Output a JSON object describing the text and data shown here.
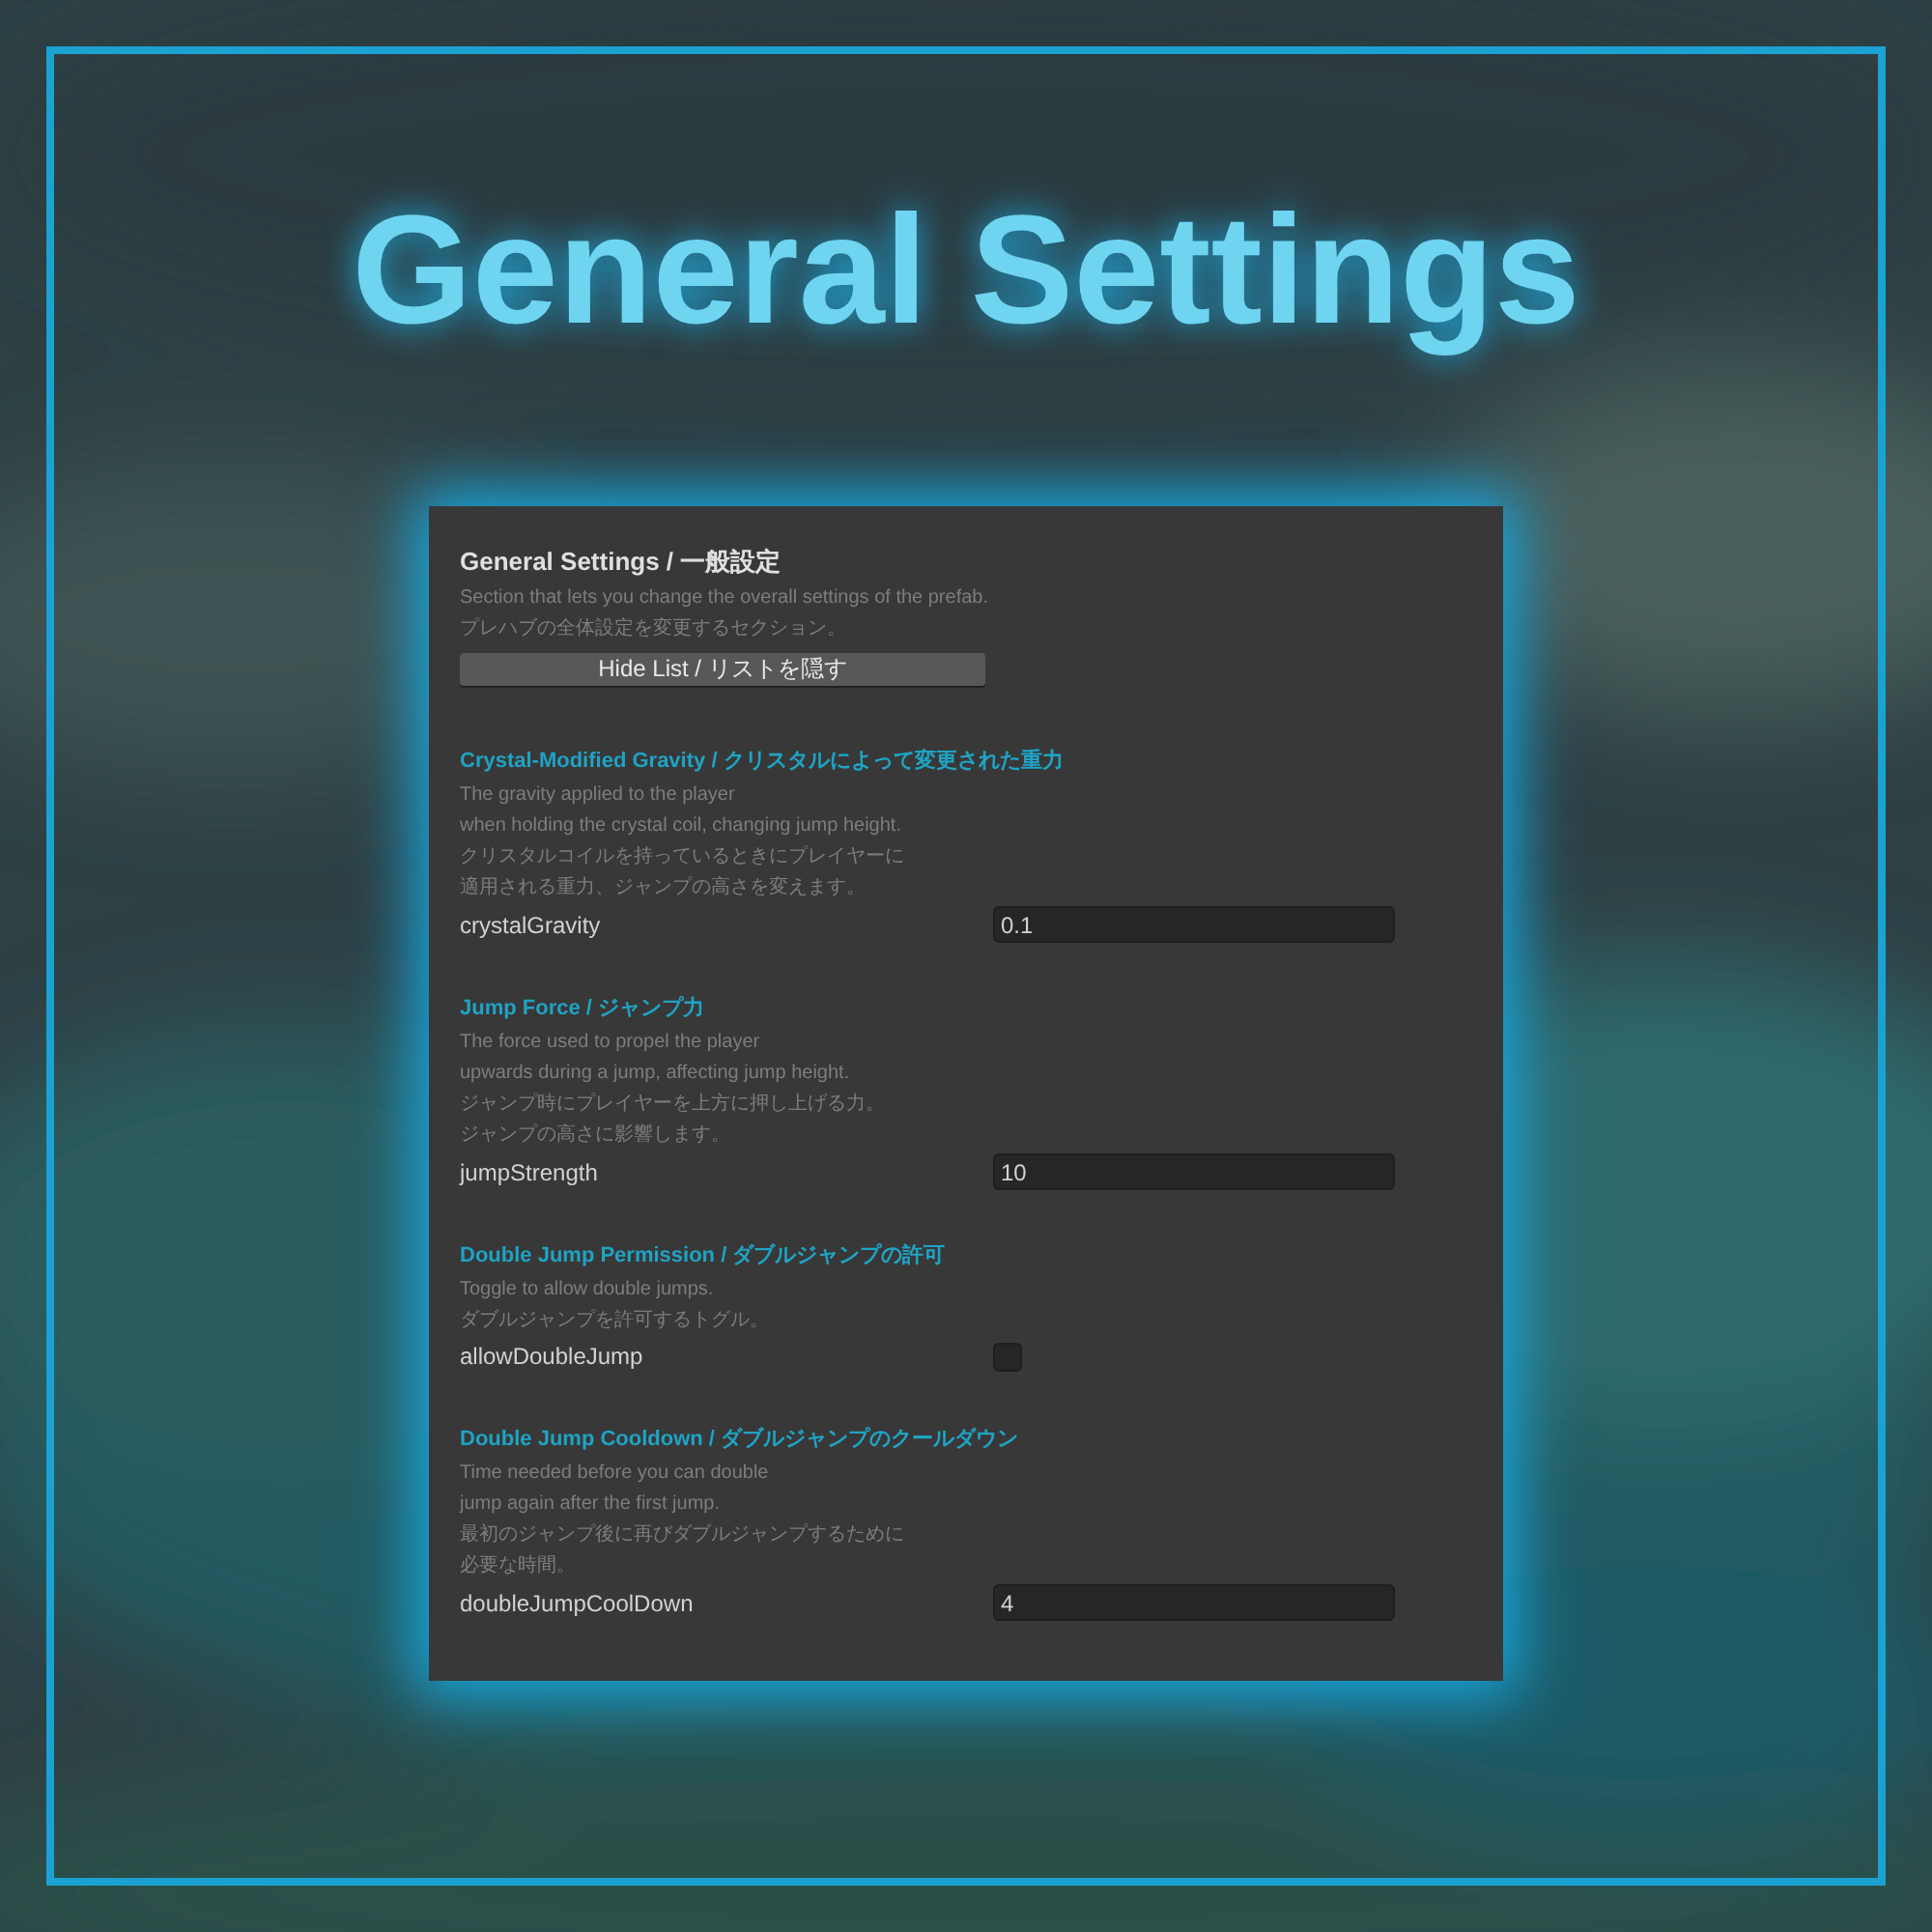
{
  "banner_title": "General Settings",
  "panel": {
    "title": "General Settings / 一般設定",
    "description": [
      "Section that lets you change the overall settings of the prefab.",
      "プレハブの全体設定を変更するセクション。"
    ],
    "button": "Hide List / リストを隠す",
    "sections": [
      {
        "heading": "Crystal-Modified Gravity / クリスタルによって変更された重力",
        "description": [
          "The gravity applied to the player",
          "when holding the crystal coil, changing jump height.",
          "クリスタルコイルを持っているときにプレイヤーに",
          "適用される重力、ジャンプの高さを変えます。"
        ],
        "field": {
          "kind": "number",
          "label": "crystalGravity",
          "value": "0.1"
        }
      },
      {
        "heading": "Jump Force / ジャンプ力",
        "description": [
          "The force used to propel the player",
          "upwards during a jump, affecting jump height.",
          "ジャンプ時にプレイヤーを上方に押し上げる力。",
          "ジャンプの高さに影響します。"
        ],
        "field": {
          "kind": "number",
          "label": "jumpStrength",
          "value": "10"
        }
      },
      {
        "heading": "Double Jump Permission / ダブルジャンプの許可",
        "description": [
          "Toggle to allow double jumps.",
          "ダブルジャンプを許可するトグル。"
        ],
        "field": {
          "kind": "checkbox",
          "label": "allowDoubleJump",
          "checked": false
        }
      },
      {
        "heading": "Double Jump Cooldown / ダブルジャンプのクールダウン",
        "description": [
          "Time needed before you can double",
          "jump again after the first jump.",
          "最初のジャンプ後に再びダブルジャンプするために",
          "必要な時間。"
        ],
        "field": {
          "kind": "number",
          "label": "doubleJumpCoolDown",
          "value": "4"
        }
      }
    ]
  }
}
